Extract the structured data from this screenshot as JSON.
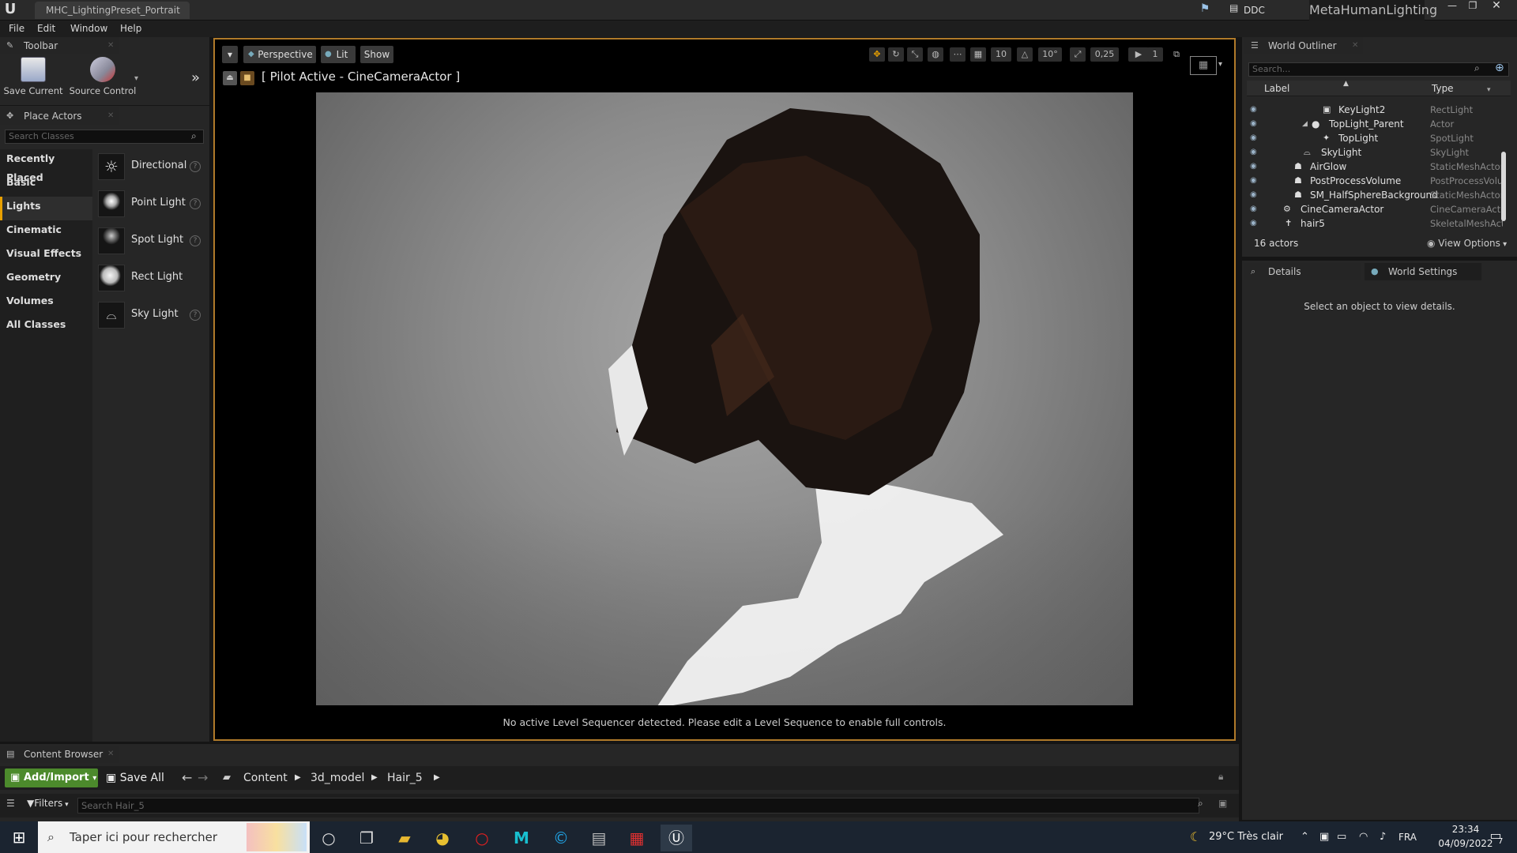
{
  "title_bar": {
    "doc_tab": "MHC_LightingPreset_Portrait",
    "ddc_label": "DDC",
    "project_name": "MetaHumanLighting"
  },
  "menu": [
    "File",
    "Edit",
    "Window",
    "Help"
  ],
  "toolbar_panel": {
    "tab_label": "Toolbar",
    "save_current": "Save Current",
    "source_control": "Source Control"
  },
  "place_actors": {
    "tab_label": "Place Actors",
    "search_placeholder": "Search Classes",
    "categories": [
      "Recently Placed",
      "Basic",
      "Lights",
      "Cinematic",
      "Visual Effects",
      "Geometry",
      "Volumes",
      "All Classes"
    ],
    "selected_category": "Lights",
    "items": [
      "Directional",
      "Point Light",
      "Spot Light",
      "Rect Light",
      "Sky Light"
    ]
  },
  "viewport": {
    "perspective": "Perspective",
    "lit": "Lit",
    "show": "Show",
    "grid_snap": "10",
    "rot_snap": "10°",
    "scale_snap": "0,25",
    "cam_speed": "1",
    "pilot_label": "[ Pilot Active - CineCameraActor ]",
    "status": "No active Level Sequencer detected. Please edit a Level Sequence to enable full controls."
  },
  "world_outliner": {
    "tab_label": "World Outliner",
    "search_placeholder": "Search...",
    "col_label": "Label",
    "col_type": "Type",
    "rows": [
      {
        "label": "KeyLight2",
        "type": "RectLight"
      },
      {
        "label": "TopLight_Parent",
        "type": "Actor"
      },
      {
        "label": "TopLight",
        "type": "SpotLight"
      },
      {
        "label": "SkyLight",
        "type": "SkyLight"
      },
      {
        "label": "AirGlow",
        "type": "StaticMeshActor"
      },
      {
        "label": "PostProcessVolume",
        "type": "PostProcessVolume"
      },
      {
        "label": "SM_HalfSphereBackground",
        "type": "StaticMeshActor"
      },
      {
        "label": "CineCameraActor",
        "type": "CineCameraActor"
      },
      {
        "label": "hair5",
        "type": "SkeletalMeshActor"
      }
    ],
    "actor_count": "16 actors",
    "view_options": "View Options"
  },
  "details": {
    "tab_details": "Details",
    "tab_world_settings": "World Settings",
    "empty_message": "Select an object to view details."
  },
  "content_browser": {
    "tab_label": "Content Browser",
    "add_import": "Add/Import",
    "save_all": "Save All",
    "path": [
      "Content",
      "3d_model",
      "Hair_5"
    ],
    "filters": "Filters",
    "search_placeholder": "Search Hair_5"
  },
  "taskbar": {
    "search_placeholder": "Taper ici pour rechercher",
    "weather": "29°C  Très clair",
    "lang": "FRA",
    "time": "23:34",
    "date": "04/09/2022",
    "notif_count": "7"
  },
  "colors": {
    "accent_orange": "#e8a000",
    "add_import_green": "#4c8a2c",
    "viewport_border": "#b07a2a"
  }
}
